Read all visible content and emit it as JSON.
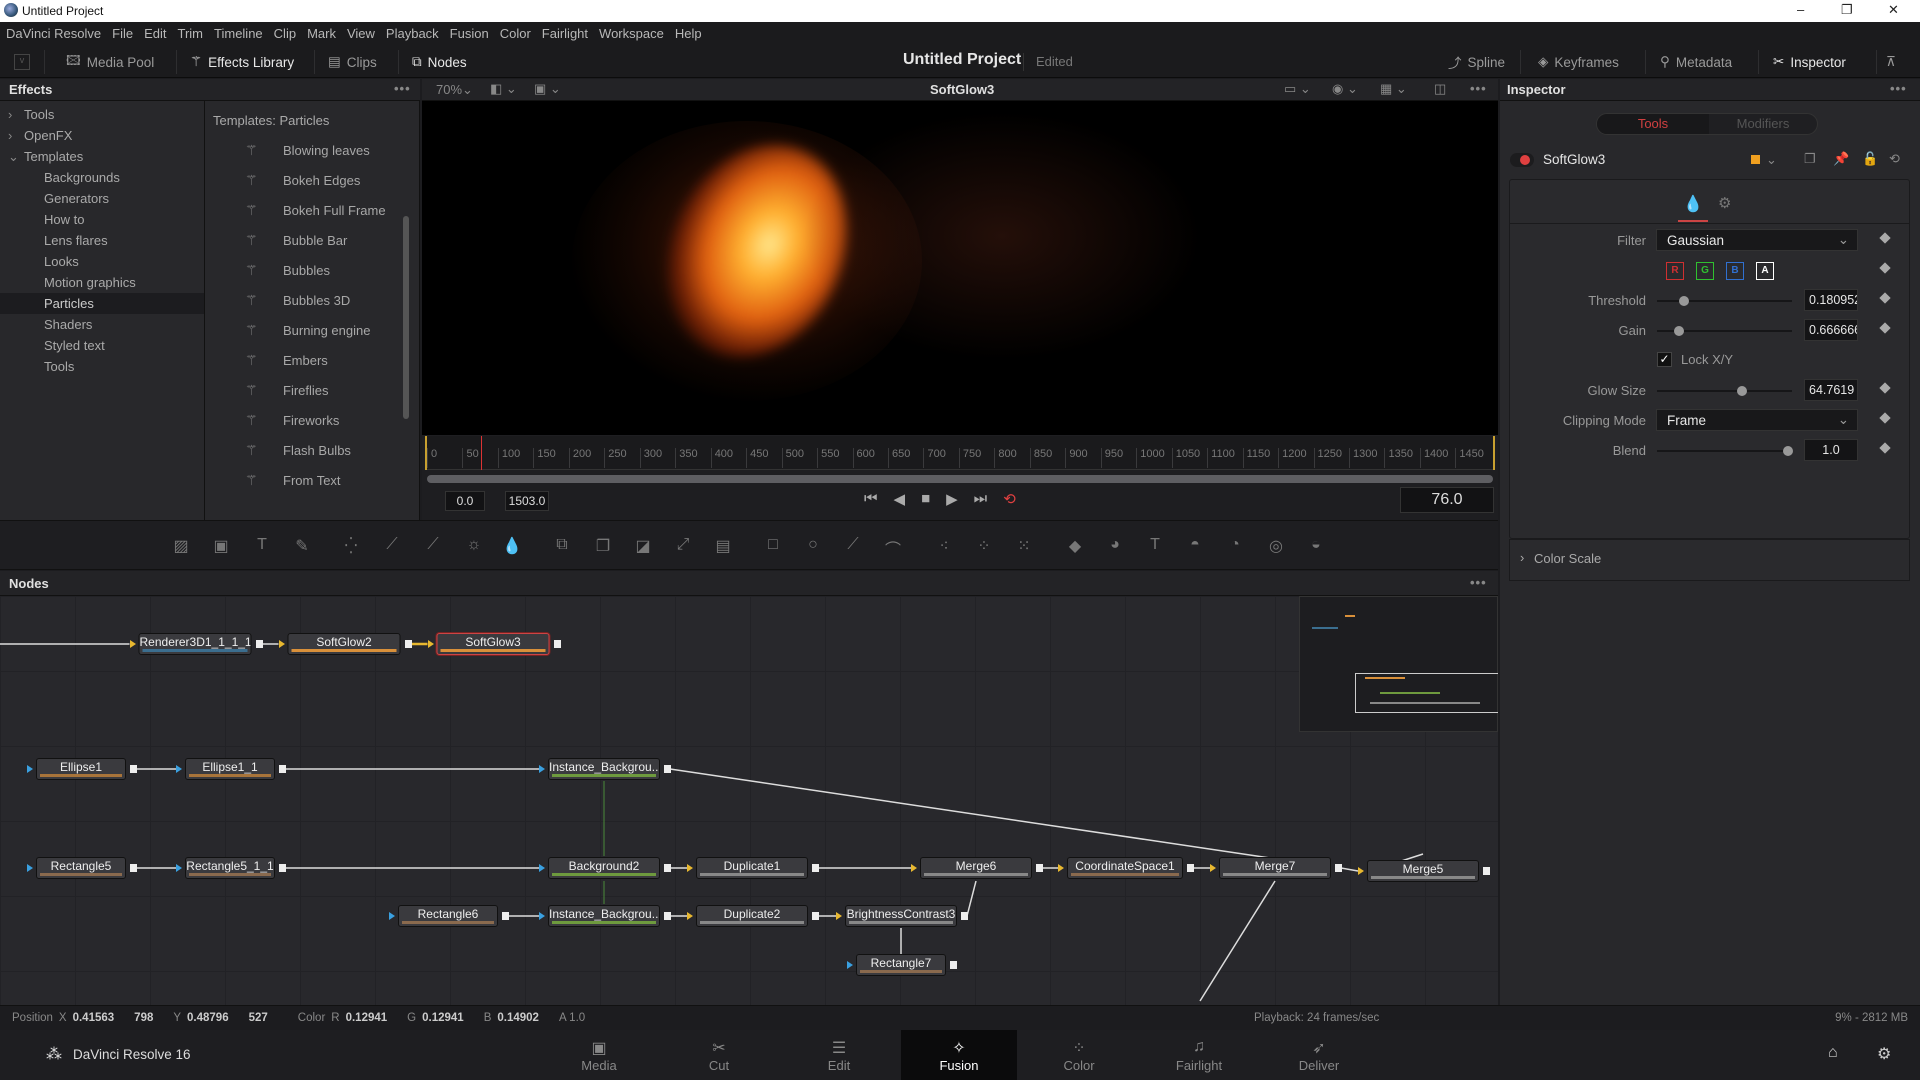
{
  "window": {
    "title": "Untitled Project",
    "minimize": "–",
    "maximize": "❐",
    "close": "✕"
  },
  "menu": [
    "DaVinci Resolve",
    "File",
    "Edit",
    "Trim",
    "Timeline",
    "Clip",
    "Mark",
    "View",
    "Playback",
    "Fusion",
    "Color",
    "Fairlight",
    "Workspace",
    "Help"
  ],
  "toolbar": {
    "media_pool": "Media Pool",
    "effects_library": "Effects Library",
    "clips": "Clips",
    "nodes": "Nodes",
    "project_title": "Untitled Project",
    "project_status": "Edited",
    "spline": "Spline",
    "keyframes": "Keyframes",
    "metadata": "Metadata",
    "inspector": "Inspector"
  },
  "effects": {
    "title": "Effects",
    "tree": [
      {
        "label": "Tools",
        "state": "collapsed"
      },
      {
        "label": "OpenFX",
        "state": "collapsed"
      },
      {
        "label": "Templates",
        "state": "expanded"
      }
    ],
    "subitems": [
      "Backgrounds",
      "Generators",
      "How to",
      "Lens flares",
      "Looks",
      "Motion graphics",
      "Particles",
      "Shaders",
      "Styled text",
      "Tools"
    ],
    "selected": "Particles",
    "list_title": "Templates: Particles",
    "templates": [
      "Blowing leaves",
      "Bokeh Edges",
      "Bokeh Full Frame",
      "Bubble Bar",
      "Bubbles",
      "Bubbles 3D",
      "Burning engine",
      "Embers",
      "Fireflies",
      "Fireworks",
      "Flash Bulbs",
      "From Text"
    ]
  },
  "viewer": {
    "zoom": "70%",
    "title": "SoftGlow3",
    "ruler_labels": [
      "0",
      "50",
      "100",
      "150",
      "200",
      "250",
      "300",
      "350",
      "400",
      "450",
      "500",
      "550",
      "600",
      "650",
      "700",
      "750",
      "800",
      "850",
      "900",
      "950",
      "1000",
      "1050",
      "1100",
      "1150",
      "1200",
      "1250",
      "1300",
      "1350",
      "1400",
      "1450"
    ],
    "range_end": 1503,
    "start": "0.0",
    "end": "1503.0",
    "current": "76.0",
    "playhead_frame": 76
  },
  "tools_icons": [
    "background-icon",
    "image-plane-icon",
    "text-icon",
    "paint-icon",
    "particle-emitter-icon",
    "color-curves-icon",
    "color-corrector-icon",
    "brightness-icon",
    "blur-icon",
    "transform-icon",
    "merge-icon",
    "matte-control-icon",
    "resize-icon",
    "letterbox-icon",
    "rectangle-mask-icon",
    "ellipse-mask-icon",
    "polygon-mask-icon",
    "bspline-mask-icon",
    "pemitter-icon",
    "prender-icon",
    "pmerge-icon",
    "shape3d-icon",
    "merge3d-icon",
    "text3d-icon",
    "camera3d-icon",
    "renderer3d-icon",
    "spotlight-icon",
    "imageplane3d-icon"
  ],
  "nodes": {
    "title": "Nodes",
    "items": [
      {
        "id": "r3d",
        "name": "Renderer3D1_1_1_1",
        "bar": "#3b6e8f"
      },
      {
        "id": "sg2",
        "name": "SoftGlow2",
        "bar": "#d9903a"
      },
      {
        "id": "sg3",
        "name": "SoftGlow3",
        "bar": "#d9903a"
      },
      {
        "id": "el1",
        "name": "Ellipse1",
        "bar": "#a8743a"
      },
      {
        "id": "el11",
        "name": "Ellipse1_1",
        "bar": "#a8743a"
      },
      {
        "id": "ib1",
        "name": "Instance_Backgrou...",
        "bar": "#6e9a3e"
      },
      {
        "id": "re5",
        "name": "Rectangle5",
        "bar": "#8a6a4e"
      },
      {
        "id": "re511",
        "name": "Rectangle5_1_1",
        "bar": "#8a6a4e"
      },
      {
        "id": "bg2",
        "name": "Background2",
        "bar": "#6e9a3e"
      },
      {
        "id": "du1",
        "name": "Duplicate1",
        "bar": "#888"
      },
      {
        "id": "m6",
        "name": "Merge6",
        "bar": "#888"
      },
      {
        "id": "cs1",
        "name": "CoordinateSpace1",
        "bar": "#8a6a4e"
      },
      {
        "id": "m7",
        "name": "Merge7",
        "bar": "#888"
      },
      {
        "id": "m5",
        "name": "Merge5",
        "bar": "#888"
      },
      {
        "id": "re6",
        "name": "Rectangle6",
        "bar": "#8a6a4e"
      },
      {
        "id": "ib2",
        "name": "Instance_Backgrou...",
        "bar": "#6e9a3e"
      },
      {
        "id": "du2",
        "name": "Duplicate2",
        "bar": "#888"
      },
      {
        "id": "bc3",
        "name": "BrightnessContrast3",
        "bar": "#888"
      },
      {
        "id": "re7",
        "name": "Rectangle7",
        "bar": "#8a6a4e"
      }
    ]
  },
  "inspector": {
    "title": "Inspector",
    "tab_tools": "Tools",
    "tab_modifiers": "Modifiers",
    "node_name": "SoftGlow3",
    "node_color": "#f0a020",
    "filter_label": "Filter",
    "filter_value": "Gaussian",
    "channels": [
      {
        "label": "R",
        "color": "#d03030"
      },
      {
        "label": "G",
        "color": "#30c030"
      },
      {
        "label": "B",
        "color": "#3070d0"
      },
      {
        "label": "A",
        "color": "#ffffff"
      }
    ],
    "threshold_label": "Threshold",
    "threshold_value": "0.180952",
    "threshold_pos": 0.2,
    "gain_label": "Gain",
    "gain_value": "0.666666",
    "gain_pos": 0.16,
    "lock_label": "Lock X/Y",
    "lock_checked": true,
    "glow_label": "Glow Size",
    "glow_value": "64.7619",
    "glow_pos": 0.63,
    "clip_label": "Clipping Mode",
    "clip_value": "Frame",
    "blend_label": "Blend",
    "blend_value": "1.0",
    "blend_pos": 0.97,
    "color_scale": "Color Scale"
  },
  "status": {
    "position": "Position",
    "x_label": "X",
    "x": "0.41563",
    "x_px": "798",
    "y_label": "Y",
    "y": "0.48796",
    "y_px": "527",
    "color": "Color",
    "r_label": "R",
    "r": "0.12941",
    "g_label": "G",
    "g": "0.12941",
    "b_label": "B",
    "b": "0.14902",
    "a": "A 1.0",
    "playback": "Playback: 24 frames/sec",
    "memory": "9% - 2812 MB"
  },
  "pages": {
    "app": "DaVinci Resolve 16",
    "items": [
      {
        "label": "Media",
        "icon": "▣"
      },
      {
        "label": "Cut",
        "icon": "✂"
      },
      {
        "label": "Edit",
        "icon": "☰"
      },
      {
        "label": "Fusion",
        "icon": "✧"
      },
      {
        "label": "Color",
        "icon": "⁘"
      },
      {
        "label": "Fairlight",
        "icon": "♫"
      },
      {
        "label": "Deliver",
        "icon": "➶"
      }
    ],
    "active": "Fusion"
  }
}
